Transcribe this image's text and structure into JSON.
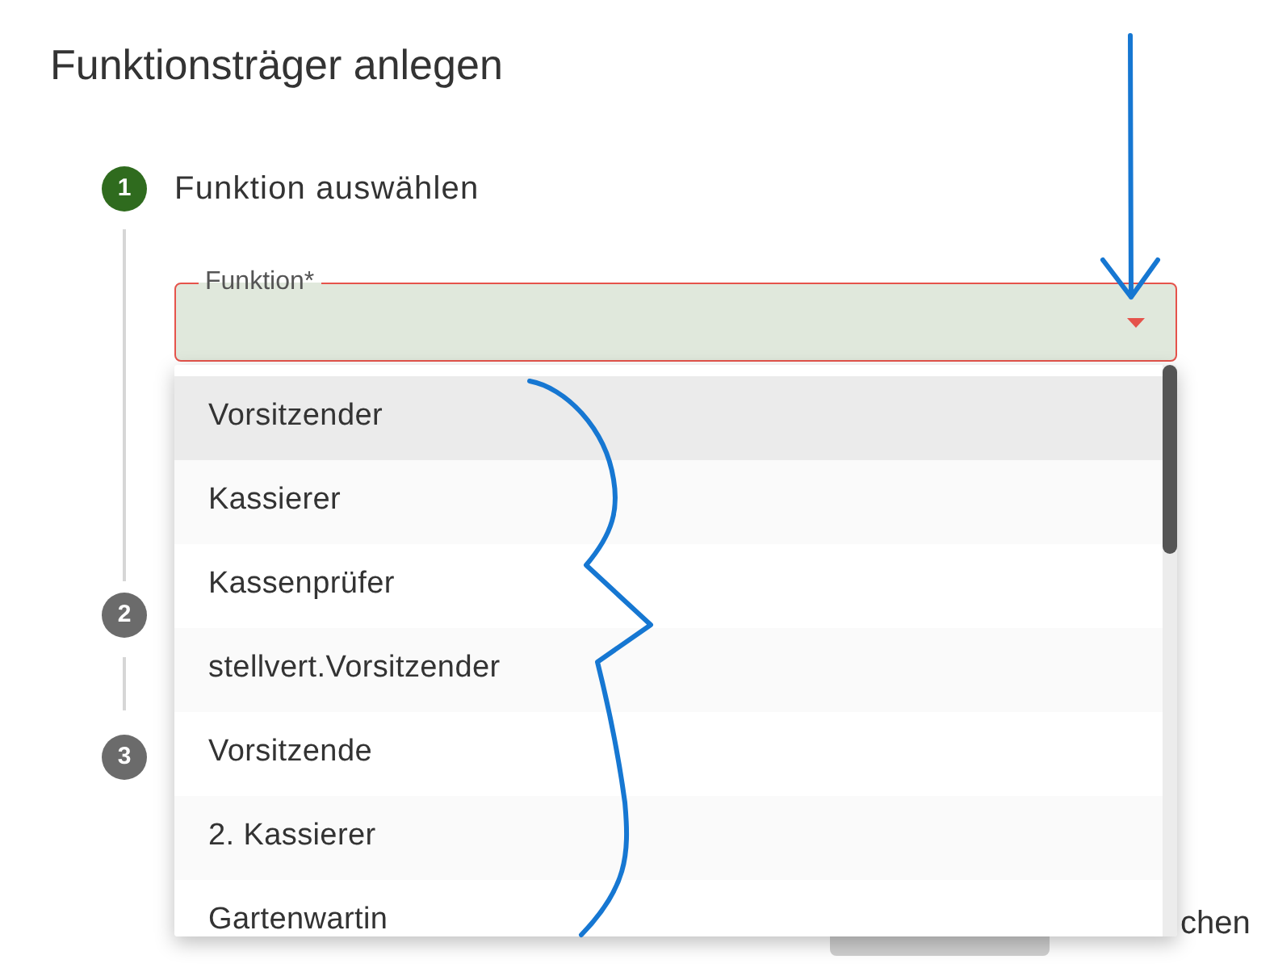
{
  "title": "Funktionsträger anlegen",
  "steps": [
    {
      "number": "1",
      "label": "Funktion auswählen",
      "active": true,
      "field": {
        "label": "Funktion*",
        "error": true,
        "options": [
          {
            "label": "Vorsitzender",
            "active": true
          },
          {
            "label": "Kassierer",
            "active": false
          },
          {
            "label": "Kassenprüfer",
            "active": false
          },
          {
            "label": "stellvert.Vorsitzender",
            "active": false
          },
          {
            "label": "Vorsitzende",
            "active": false
          },
          {
            "label": "2. Kassierer",
            "active": false
          },
          {
            "label": "Gartenwartin",
            "active": false
          }
        ]
      }
    },
    {
      "number": "2",
      "active": false
    },
    {
      "number": "3",
      "active": false
    }
  ],
  "footer": {
    "text_button": "chen"
  }
}
